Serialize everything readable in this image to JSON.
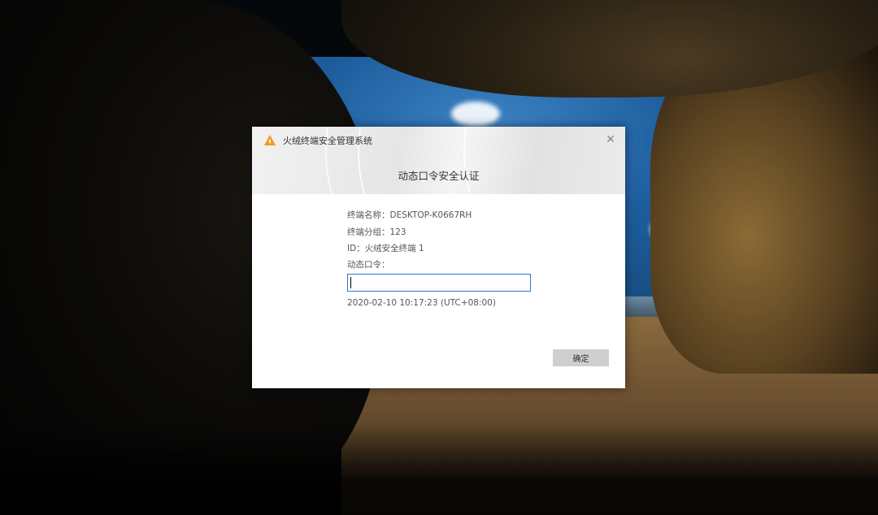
{
  "dialog": {
    "app_title": "火绒终端安全管理系统",
    "heading": "动态口令安全认证",
    "close_glyph": "✕",
    "fields": {
      "terminal_name_label": "终端名称：",
      "terminal_name_value": "DESKTOP-K0667RH",
      "terminal_group_label": "终端分组：",
      "terminal_group_value": "123",
      "id_label": "ID：",
      "id_value": "火绒安全终端 1",
      "otp_label": "动态口令："
    },
    "otp_input_value": "",
    "timestamp": "2020-02-10 10:17:23 (UTC+08:00)",
    "confirm_label": "确定"
  },
  "colors": {
    "input_border": "#2a77c9",
    "button_bg": "#cfcfcf",
    "logo_orange": "#f39a1e"
  }
}
